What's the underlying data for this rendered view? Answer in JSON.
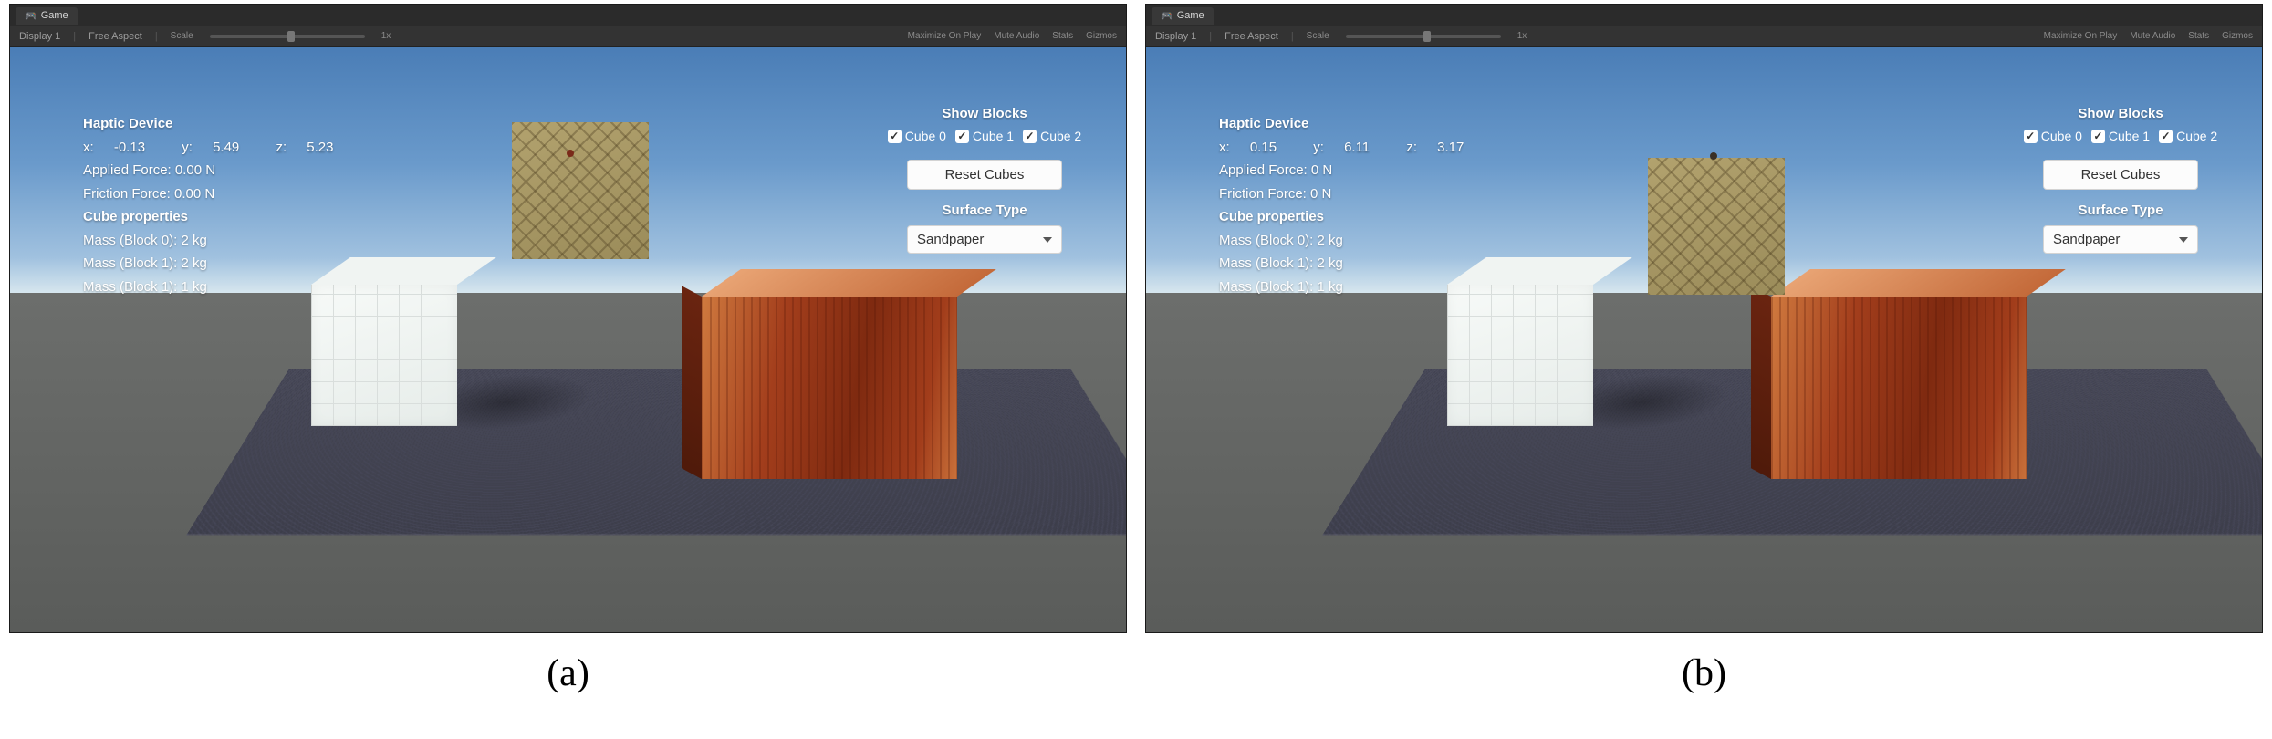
{
  "panels": [
    {
      "id": "a",
      "caption": "(a)",
      "tab_label": "Game",
      "toolbar": {
        "display": "Display 1",
        "aspect": "Free Aspect",
        "scale_label": "Scale",
        "scale_value": "1x",
        "right_items": [
          "Maximize On Play",
          "Mute Audio",
          "Stats",
          "Gizmos"
        ]
      },
      "hud_left": {
        "heading": "Haptic Device",
        "coords": {
          "x_label": "x:",
          "x": "-0.13",
          "y_label": "y:",
          "y": "5.49",
          "z_label": "z:",
          "z": "5.23"
        },
        "applied_force": "Applied Force: 0.00 N",
        "friction_force": "Friction Force: 0.00 N",
        "cube_heading": "Cube properties",
        "masses": [
          "Mass (Block 0): 2 kg",
          "Mass (Block 1): 2 kg",
          "Mass (Block 1): 1 kg"
        ]
      },
      "hud_right": {
        "show_blocks_label": "Show Blocks",
        "checks": [
          {
            "label": "Cube 0",
            "checked": true
          },
          {
            "label": "Cube 1",
            "checked": true
          },
          {
            "label": "Cube 2",
            "checked": true
          }
        ],
        "reset_label": "Reset Cubes",
        "surface_type_label": "Surface Type",
        "surface_selected": "Sandpaper"
      }
    },
    {
      "id": "b",
      "caption": "(b)",
      "tab_label": "Game",
      "toolbar": {
        "display": "Display 1",
        "aspect": "Free Aspect",
        "scale_label": "Scale",
        "scale_value": "1x",
        "right_items": [
          "Maximize On Play",
          "Mute Audio",
          "Stats",
          "Gizmos"
        ]
      },
      "hud_left": {
        "heading": "Haptic Device",
        "coords": {
          "x_label": "x:",
          "x": "0.15",
          "y_label": "y:",
          "y": "6.11",
          "z_label": "z:",
          "z": "3.17"
        },
        "applied_force": "Applied Force: 0 N",
        "friction_force": "Friction Force: 0 N",
        "cube_heading": "Cube properties",
        "masses": [
          "Mass (Block 0): 2 kg",
          "Mass (Block 1): 2 kg",
          "Mass (Block 1): 1 kg"
        ]
      },
      "hud_right": {
        "show_blocks_label": "Show Blocks",
        "checks": [
          {
            "label": "Cube 0",
            "checked": true
          },
          {
            "label": "Cube 1",
            "checked": true
          },
          {
            "label": "Cube 2",
            "checked": true
          }
        ],
        "reset_label": "Reset Cubes",
        "surface_type_label": "Surface Type",
        "surface_selected": "Sandpaper"
      }
    }
  ]
}
